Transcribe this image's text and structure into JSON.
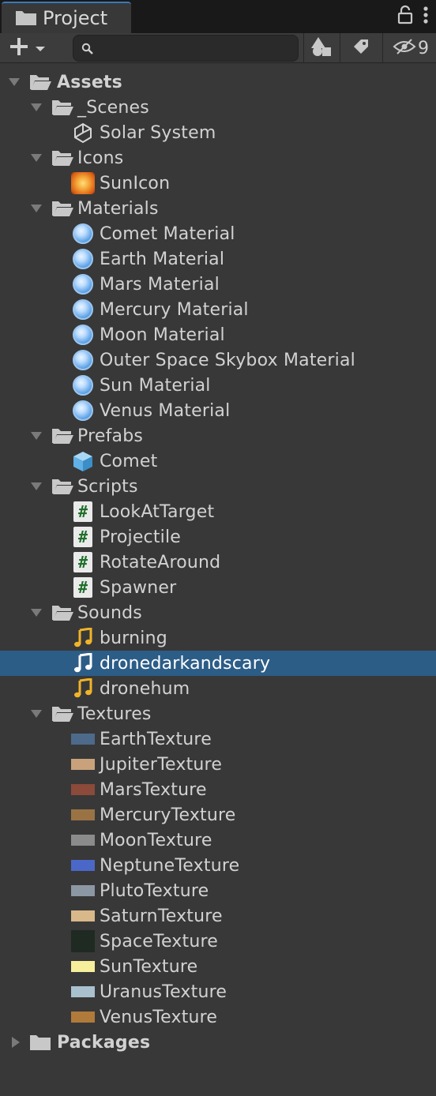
{
  "tab": {
    "title": "Project"
  },
  "toolbar": {
    "search": {
      "value": "",
      "placeholder": ""
    },
    "hidden_count": "9"
  },
  "tree": {
    "assets_label": "Assets",
    "scenes": {
      "label": "_Scenes",
      "items": [
        "Solar System"
      ]
    },
    "icons": {
      "label": "Icons",
      "items": [
        "SunIcon"
      ]
    },
    "materials": {
      "label": "Materials",
      "items": [
        "Comet Material",
        "Earth Material",
        "Mars Material",
        "Mercury Material",
        "Moon Material",
        "Outer Space Skybox Material",
        "Sun Material",
        "Venus Material"
      ]
    },
    "prefabs": {
      "label": "Prefabs",
      "items": [
        "Comet"
      ]
    },
    "scripts": {
      "label": "Scripts",
      "items": [
        "LookAtTarget",
        "Projectile",
        "RotateAround",
        "Spawner"
      ]
    },
    "sounds": {
      "label": "Sounds",
      "items": [
        "burning",
        "dronedarkandscary",
        "dronehum"
      ],
      "selected": "dronedarkandscary"
    },
    "textures": {
      "label": "Textures",
      "items": [
        "EarthTexture",
        "JupiterTexture",
        "MarsTexture",
        "MercuryTexture",
        "MoonTexture",
        "NeptuneTexture",
        "PlutoTexture",
        "SaturnTexture",
        "SpaceTexture",
        "SunTexture",
        "UranusTexture",
        "VenusTexture"
      ]
    },
    "packages_label": "Packages"
  },
  "colors": {
    "selection": "#2c5d87",
    "background": "#383838",
    "audio_icon": "#f0b429",
    "texture_swatches": {
      "EarthTexture": "#4d6a8a",
      "JupiterTexture": "#c9a27c",
      "MarsTexture": "#8c4a3a",
      "MercuryTexture": "#9a7344",
      "MoonTexture": "#8b8b8b",
      "NeptuneTexture": "#4b68c8",
      "PlutoTexture": "#8c97a4",
      "SaturnTexture": "#d9b88a",
      "SpaceTexture": "#1f2a22",
      "SunTexture": "#f8ef9c",
      "UranusTexture": "#a9c1cf",
      "VenusTexture": "#b07a3a"
    }
  }
}
